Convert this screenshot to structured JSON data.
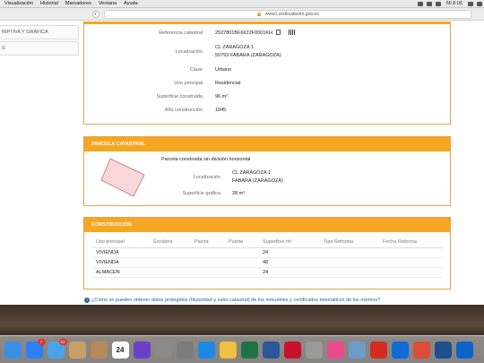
{
  "menubar": {
    "items": [
      "Visualización",
      "Historial",
      "Marcadores",
      "Ventana",
      "Ayuda"
    ],
    "clock": "Mi 8:06"
  },
  "browser": {
    "url": "www1.sedecatastro.gob.es"
  },
  "sidebar": {
    "items": [
      "RIPTIVA Y GRÁFICA",
      "S"
    ]
  },
  "inmueble": {
    "rows": [
      {
        "label": "Referencia catastral",
        "value": "2527801BF6622F0001KH"
      },
      {
        "label": "Localización",
        "value": "CL ZARAGOZA 1",
        "value2": "50793 FABARA (ZARAGOZA)"
      },
      {
        "label": "Clase",
        "value": "Urbano"
      },
      {
        "label": "Uso principal",
        "value": "Residencial"
      },
      {
        "label": "Superficie construida",
        "value": "96 m²"
      },
      {
        "label": "Año construcción",
        "value": "1945"
      }
    ]
  },
  "parcela": {
    "title": "PARCELA CATASTRAL",
    "description": "Parcela construida sin división horizontal",
    "loc_label": "Localización",
    "loc_line1": "CL ZARAGOZA 1",
    "loc_line2": "FABARA (ZARAGOZA)",
    "sup_label": "Superficie gráfica",
    "sup_value": "28 m²"
  },
  "construccion": {
    "title": "CONSTRUCCIÓN",
    "headers": [
      "Uso principal",
      "Escalera",
      "Planta",
      "Puerta",
      "Superficie m²",
      "Tipo Reforma",
      "Fecha Reforma"
    ],
    "rows": [
      [
        "VIVIENDA",
        "",
        "",
        "",
        "24",
        "",
        ""
      ],
      [
        "VIVIENDA",
        "",
        "",
        "",
        "48",
        "",
        ""
      ],
      [
        "ALMACEN",
        "",
        "",
        "",
        "24",
        "",
        ""
      ]
    ]
  },
  "help": {
    "text": "¿Cómo se pueden obtener datos protegidos (titularidad y valor catastral) de los inmuebles y certificados telemáticos de los mismos?"
  },
  "dock": {
    "apps": [
      {
        "name": "finder-icon",
        "color": "#3a8ee6"
      },
      {
        "name": "app-store-icon",
        "color": "#2d7ff9",
        "badge": "7"
      },
      {
        "name": "mail-icon",
        "color": "#4aa3e8",
        "badge": "10"
      },
      {
        "name": "notes-icon",
        "color": "#c9a064"
      },
      {
        "name": "contacts-icon",
        "color": "#b58a5a"
      },
      {
        "name": "calendar-icon",
        "color": "#ffffff",
        "label": "24"
      },
      {
        "name": "imovie-icon",
        "color": "#6a3fc8"
      },
      {
        "name": "no-entry-icon",
        "color": "#8a8a8a"
      },
      {
        "name": "system-preferences-icon",
        "color": "#7c7c7c"
      },
      {
        "name": "safari-icon",
        "color": "#1e88e5"
      },
      {
        "name": "photos-icon",
        "color": "#f0c040"
      },
      {
        "name": "excel-icon",
        "color": "#1f7244"
      },
      {
        "name": "word-icon",
        "color": "#2b579a"
      },
      {
        "name": "acrobat-icon",
        "color": "#c8102e"
      },
      {
        "name": "blocked-app-icon",
        "color": "#9a9a9a"
      },
      {
        "name": "itunes-icon",
        "color": "#ec4c8c"
      },
      {
        "name": "preview-icon",
        "color": "#6f9bc8"
      },
      {
        "name": "acrobat-reader-icon",
        "color": "#d52b1e"
      },
      {
        "name": "teamviewer-icon",
        "color": "#0e6bd7"
      },
      {
        "name": "chrome-icon",
        "color": "#dd4b39"
      },
      {
        "name": "quicktime-icon",
        "color": "#1c4f8c"
      },
      {
        "name": "outlook-icon",
        "color": "#0a64c8"
      }
    ]
  },
  "colors": {
    "accent": "#f5a623",
    "parcel_fill": "#f8d7da",
    "parcel_stroke": "#c9888e",
    "link": "#2a5db0"
  }
}
